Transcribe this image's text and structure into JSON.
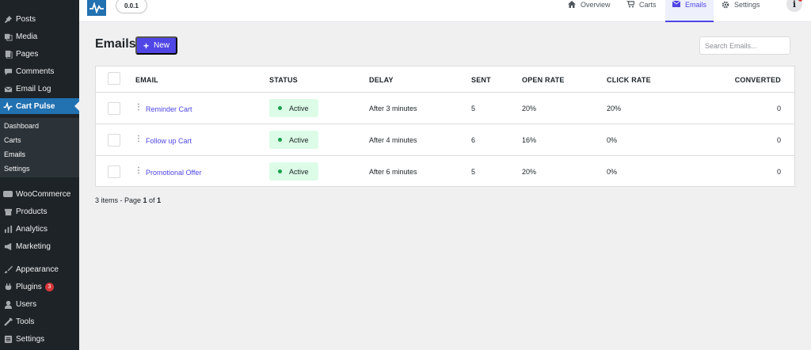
{
  "sidebar": {
    "items": [
      {
        "label": "Posts",
        "icon": "pin-icon"
      },
      {
        "label": "Media",
        "icon": "media-icon"
      },
      {
        "label": "Pages",
        "icon": "pages-icon"
      },
      {
        "label": "Comments",
        "icon": "comment-icon"
      },
      {
        "label": "Email Log",
        "icon": "envelope-icon"
      },
      {
        "label": "Cart Pulse",
        "icon": "pulse-icon"
      },
      {
        "label": "WooCommerce",
        "icon": "woo-icon"
      },
      {
        "label": "Products",
        "icon": "archive-icon"
      },
      {
        "label": "Analytics",
        "icon": "bar-chart-icon"
      },
      {
        "label": "Marketing",
        "icon": "megaphone-icon"
      },
      {
        "label": "Appearance",
        "icon": "brush-icon"
      },
      {
        "label": "Plugins",
        "icon": "plug-icon",
        "badge": "3"
      },
      {
        "label": "Users",
        "icon": "user-icon"
      },
      {
        "label": "Tools",
        "icon": "wrench-icon"
      },
      {
        "label": "Settings",
        "icon": "settings-icon"
      }
    ],
    "submenu": [
      "Dashboard",
      "Carts",
      "Emails",
      "Settings"
    ],
    "current": "Cart Pulse",
    "current_sub": "Emails"
  },
  "header": {
    "version": "0.0.1",
    "nav": [
      {
        "label": "Overview",
        "icon": "home-icon"
      },
      {
        "label": "Carts",
        "icon": "cart-icon"
      },
      {
        "label": "Emails",
        "icon": "mail-icon",
        "active": true
      },
      {
        "label": "Settings",
        "icon": "gear-icon"
      }
    ],
    "help_glyph": "i"
  },
  "page": {
    "title": "Emails",
    "new_button": "New",
    "search_placeholder": "Search Emails..."
  },
  "table": {
    "columns": [
      "EMAIL",
      "STATUS",
      "DELAY",
      "SENT",
      "OPEN RATE",
      "CLICK RATE",
      "CONVERTED"
    ],
    "rows": [
      {
        "name": "Reminder Cart",
        "status": "Active",
        "delay": "After 3 minutes",
        "sent": "5",
        "open_rate": "20%",
        "click_rate": "20%",
        "converted": "0"
      },
      {
        "name": "Follow up Cart",
        "status": "Active",
        "delay": "After 4 minutes",
        "sent": "6",
        "open_rate": "16%",
        "click_rate": "0%",
        "converted": "0"
      },
      {
        "name": "Promotional Offer",
        "status": "Active",
        "delay": "After 6 minutes",
        "sent": "5",
        "open_rate": "20%",
        "click_rate": "0%",
        "converted": "0"
      }
    ]
  },
  "footer": {
    "prefix": "3 items - Page ",
    "page": "1",
    "of": " of ",
    "total": "1"
  },
  "colors": {
    "accent": "#4f46e5",
    "wp_sidebar": "#1d2327",
    "wp_current": "#2271b1",
    "status_active_bg": "#dcfce7",
    "status_active_dot": "#16a34a"
  }
}
